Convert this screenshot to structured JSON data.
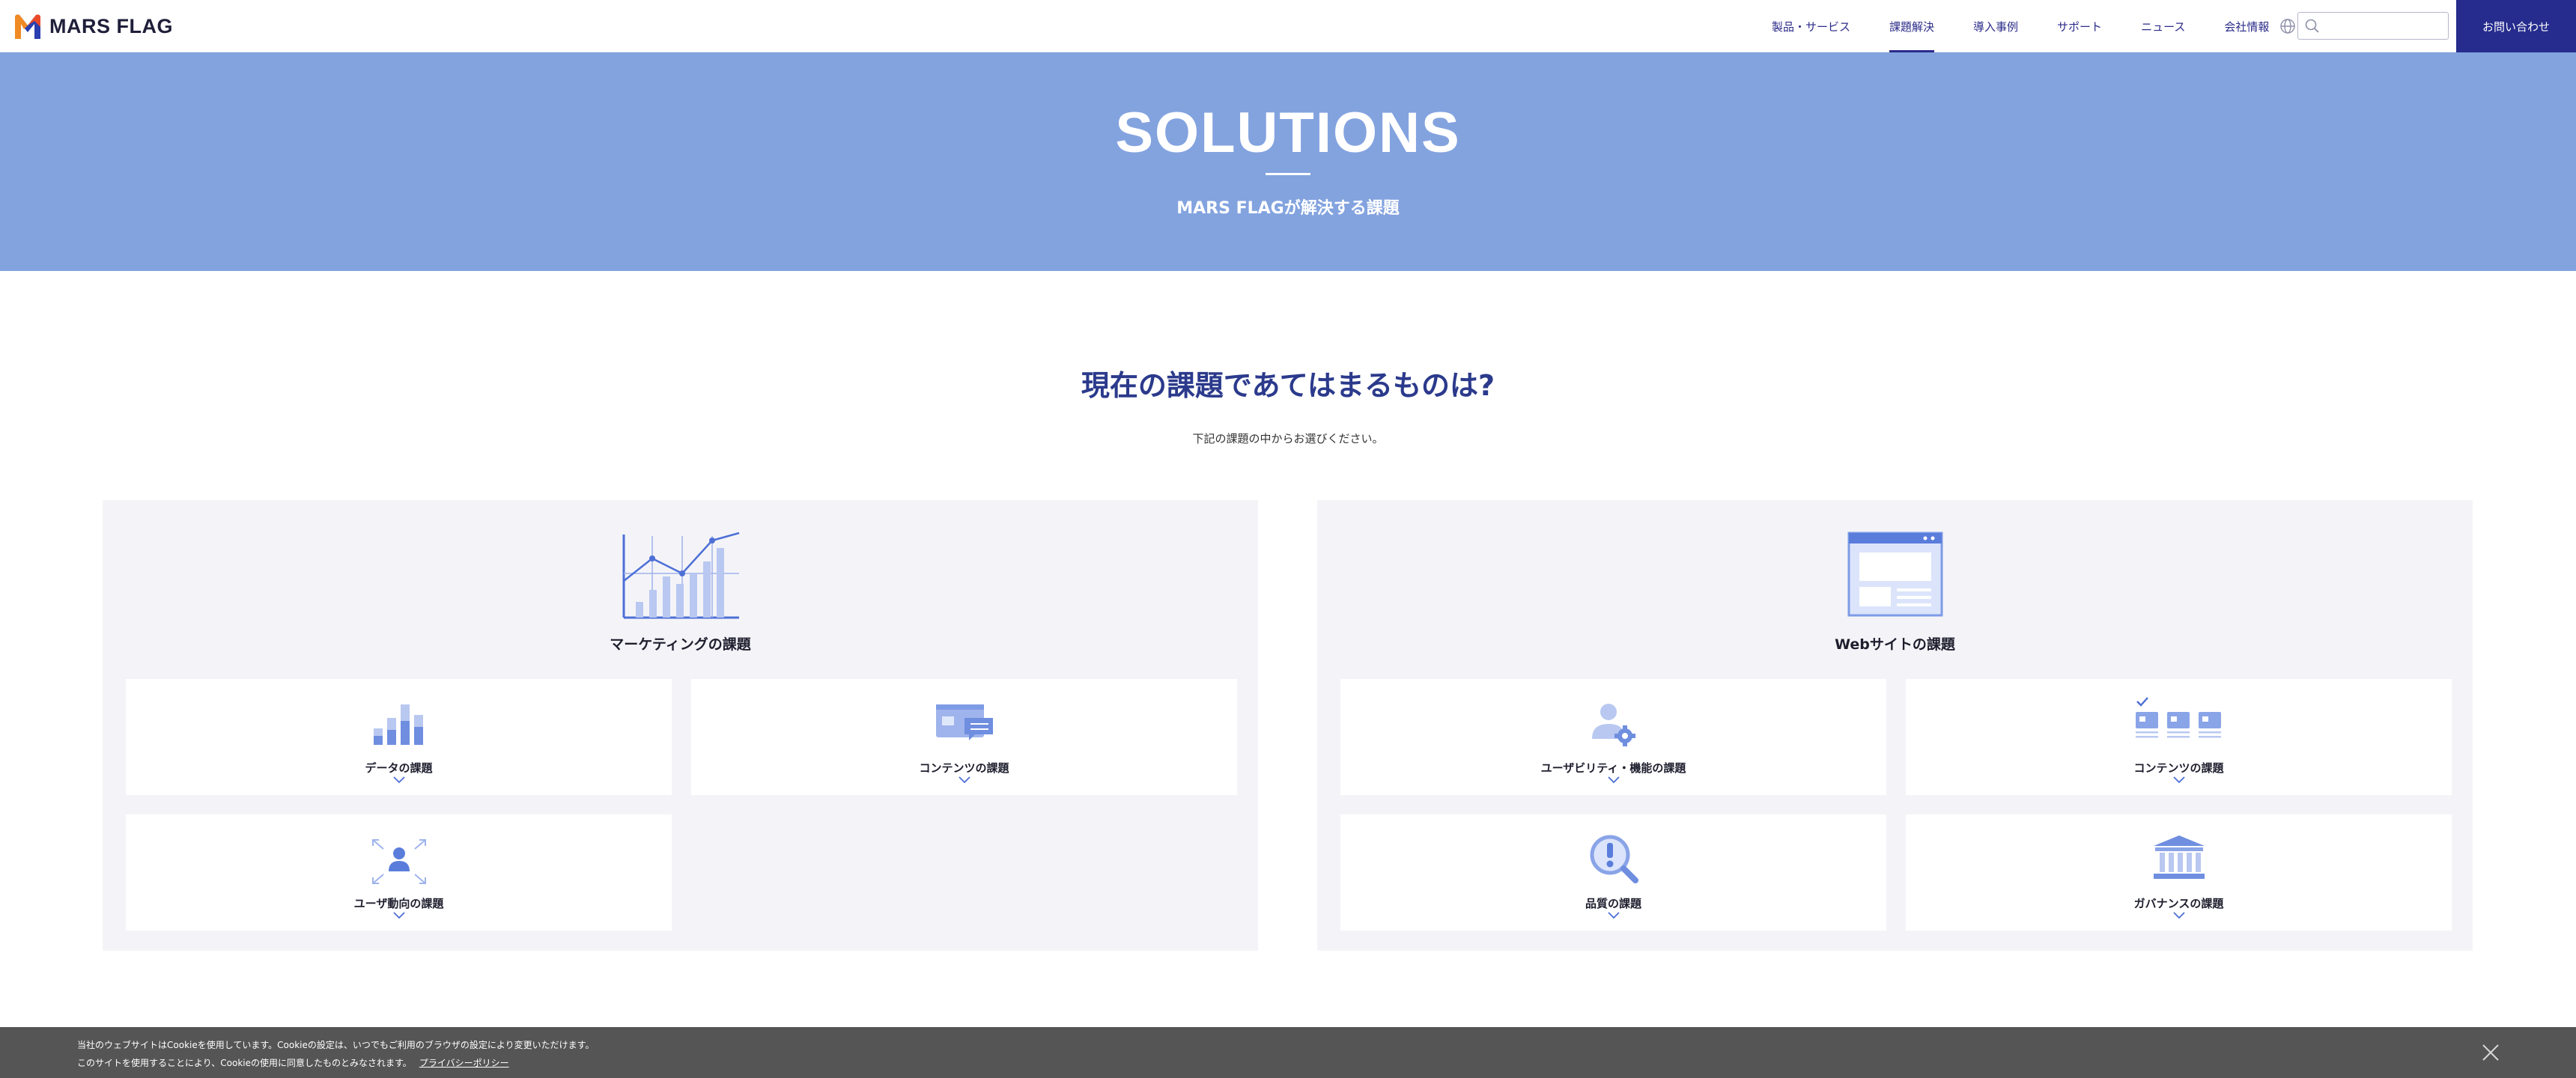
{
  "header": {
    "logo_text": "MARS FLAG",
    "nav": [
      {
        "label": "製品・サービス",
        "active": false
      },
      {
        "label": "課題解決",
        "active": true
      },
      {
        "label": "導入事例",
        "active": false
      },
      {
        "label": "サポート",
        "active": false
      },
      {
        "label": "ニュース",
        "active": false
      },
      {
        "label": "会社情報",
        "active": false
      }
    ],
    "search_placeholder": "",
    "contact_label": "お問い合わせ",
    "colors": {
      "brand": "#262c8d",
      "nav_text": "#2b2b8a"
    }
  },
  "hero": {
    "title": "SOLUTIONS",
    "subtitle": "MARS FLAGが解決する課題",
    "background": "#83a3df"
  },
  "intro": {
    "heading": "現在の課題であてはまるものは?",
    "subtext": "下記の課題の中からお選びください。"
  },
  "panels": [
    {
      "title": "マーケティングの課題",
      "illustration": "chart-illustration",
      "cards": [
        {
          "label": "データの課題",
          "icon": "bar-chart-icon"
        },
        {
          "label": "コンテンツの課題",
          "icon": "content-window-icon"
        },
        {
          "label": "ユーザ動向の課題",
          "icon": "user-expand-icon"
        }
      ]
    },
    {
      "title": "Webサイトの課題",
      "illustration": "website-illustration",
      "cards": [
        {
          "label": "ユーザビリティ・機能の課題",
          "icon": "user-gear-icon"
        },
        {
          "label": "コンテンツの課題",
          "icon": "content-cards-icon"
        },
        {
          "label": "品質の課題",
          "icon": "magnifier-exclamation-icon"
        },
        {
          "label": "ガバナンスの課題",
          "icon": "building-icon"
        }
      ]
    }
  ],
  "cookie": {
    "line1": "当社のウェブサイトはCookieを使用しています。Cookieの設定は、いつでもご利用のブラウザの設定により変更いただけます。",
    "line2": "このサイトを使用することにより、Cookieの使用に同意したものとみなされます。",
    "link": "プライバシーポリシー"
  }
}
